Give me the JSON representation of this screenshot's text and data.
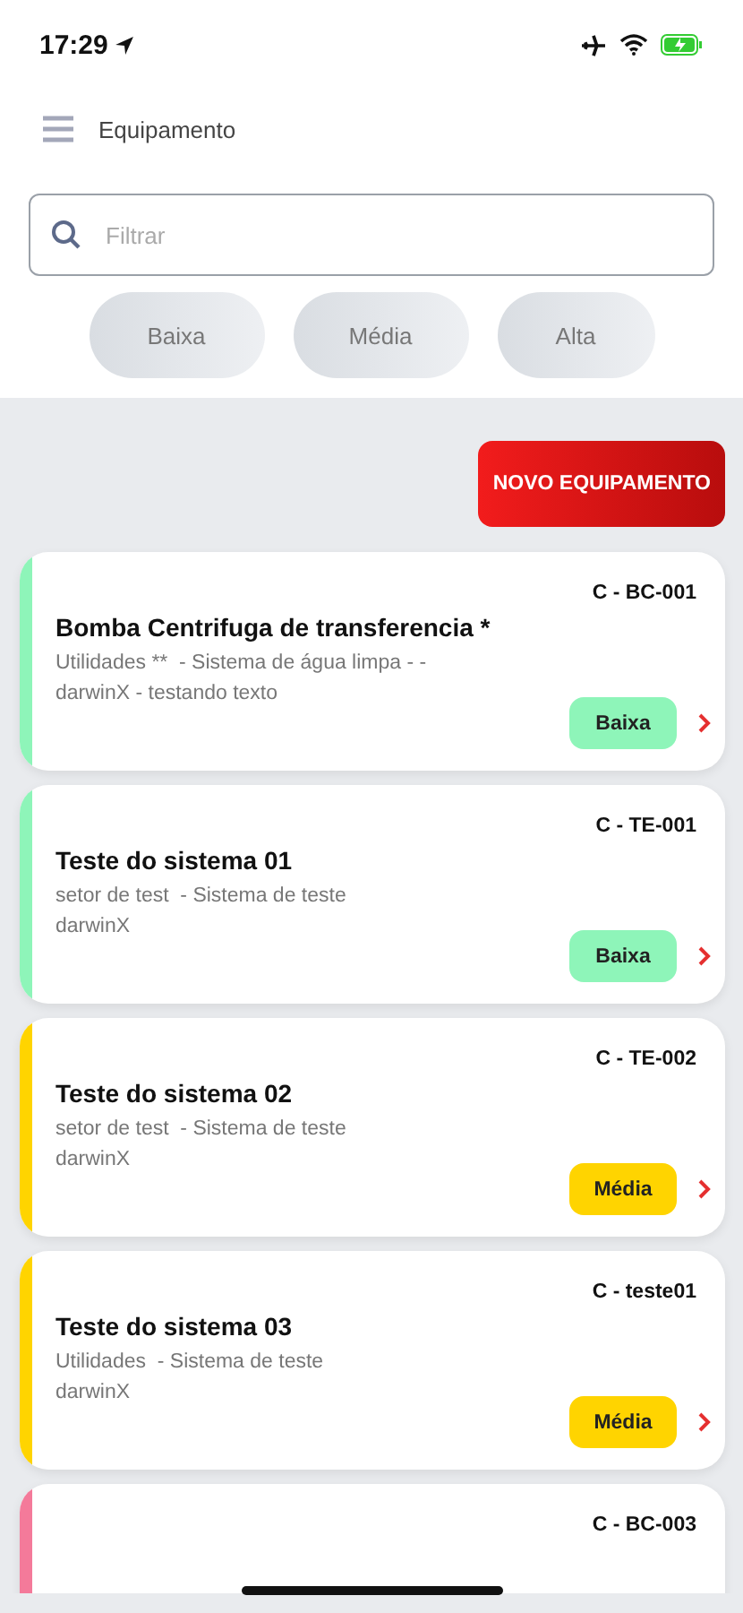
{
  "status_bar": {
    "time": "17:29"
  },
  "header": {
    "title": "Equipamento"
  },
  "search": {
    "placeholder": "Filtrar"
  },
  "filters": [
    {
      "label": "Baixa",
      "selected": false
    },
    {
      "label": "Média",
      "selected": false
    },
    {
      "label": "Alta",
      "selected": false
    }
  ],
  "new_button": "NOVO EQUIPAMENTO",
  "equipment": [
    {
      "code": "C - BC-001",
      "name": "Bomba Centrifuga de transferencia *",
      "location": "Utilidades **  - Sistema de água limpa - -",
      "owner": "darwinX - testando texto",
      "priority": "Baixa",
      "color": "#8ef5b9"
    },
    {
      "code": "C - TE-001",
      "name": "Teste do sistema 01",
      "location": "setor de test  - Sistema de teste",
      "owner": "darwinX",
      "priority": "Baixa",
      "color": "#8ef5b9"
    },
    {
      "code": "C - TE-002",
      "name": "Teste do sistema 02",
      "location": "setor de test  - Sistema de teste",
      "owner": "darwinX",
      "priority": "Média",
      "color": "#ffd400"
    },
    {
      "code": "C - teste01",
      "name": "Teste do sistema 03",
      "location": "Utilidades  - Sistema de teste",
      "owner": "darwinX",
      "priority": "Média",
      "color": "#ffd400"
    },
    {
      "code": "C - BC-003",
      "color": "#f47a9a"
    }
  ]
}
